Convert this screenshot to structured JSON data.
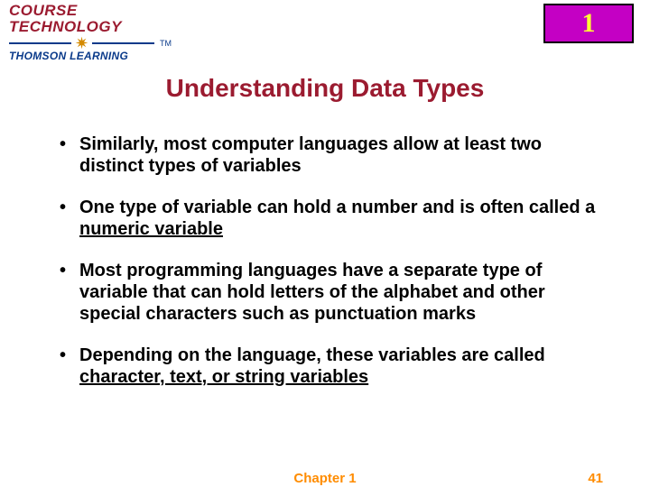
{
  "logo": {
    "line1": "COURSE",
    "line2": "TECHNOLOGY",
    "tm": "TM",
    "sub": "THOMSON LEARNING"
  },
  "chapter_badge": "1",
  "title": "Understanding Data Types",
  "bullets": [
    {
      "pre": "Similarly, most computer languages allow at least two distinct types of variables",
      "u": "",
      "post": ""
    },
    {
      "pre": "One type of variable can hold a number and is often called a ",
      "u": "numeric variable",
      "post": ""
    },
    {
      "pre": "Most programming languages have a separate type of variable that can hold letters of the alphabet and other special characters such as punctuation marks",
      "u": "",
      "post": ""
    },
    {
      "pre": "Depending on the language, these variables are called ",
      "u": "character, text, or string variables",
      "post": ""
    }
  ],
  "footer": {
    "chapter": "Chapter 1",
    "page": "41"
  }
}
